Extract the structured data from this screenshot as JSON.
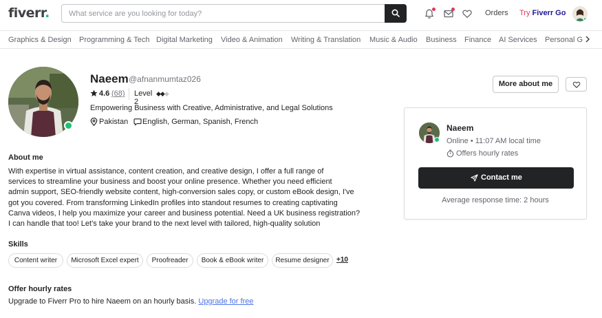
{
  "header": {
    "logo_text": "fiverr",
    "logo_dot": ".",
    "search_placeholder": "What service are you looking for today?",
    "orders_label": "Orders",
    "try_label": "Try",
    "fiverr_go_label": "Fiverr Go",
    "icons": [
      "notification-bell-icon",
      "mail-icon",
      "heart-icon"
    ]
  },
  "categories": [
    "Graphics & Design",
    "Programming & Tech",
    "Digital Marketing",
    "Video & Animation",
    "Writing & Translation",
    "Music & Audio",
    "Business",
    "Finance",
    "AI Services",
    "Personal Gr"
  ],
  "profile": {
    "name": "Naeem",
    "username": "@afnanmumtaz026",
    "rating": "4.6",
    "review_count": "(68)",
    "level": "Level 2",
    "level_marks_on": "◆◆",
    "level_marks_off": "◆",
    "tagline": "Empowering Business with Creative, Administrative, and Legal Solutions",
    "location": "Pakistan",
    "languages": "English, German, Spanish, French",
    "more_about_label": "More about me"
  },
  "contact_card": {
    "name": "Naeem",
    "status": "Online • 11:07 AM local time",
    "hourly": "Offers hourly rates",
    "contact_label": "Contact me",
    "response_time": "Average response time: 2 hours"
  },
  "about": {
    "heading": "About me",
    "lines": [
      "With expertise in virtual assistance, content creation, and creative design, I offer a full range of",
      "services to streamline your business and boost your online presence. Whether you need efficient",
      "admin support, SEO-friendly website content, high-conversion sales copy, or custom eBook design, I've",
      "got you covered. From transforming LinkedIn profiles into standout resumes to creating captivating",
      "Canva videos, I help you maximize your career and business potential. Need a UK business registration?",
      "I can handle that too! Let's take your brand to the next level with tailored, high-quality solution"
    ]
  },
  "skills": {
    "heading": "Skills",
    "items": [
      "Content writer",
      "Microsoft Excel expert",
      "Proofreader",
      "Book & eBook writer",
      "Resume designer"
    ],
    "more": "+10"
  },
  "offer": {
    "heading": "Offer hourly rates",
    "text": "Upgrade to Fiverr Pro to hire Naeem on an hourly basis.",
    "link": "Upgrade for free"
  },
  "colors": {
    "brand_green": "#1dbf73",
    "dark": "#222325",
    "link_blue": "#4a73e8",
    "accent_pink": "#e5345a",
    "go_navy": "#1e1692"
  }
}
